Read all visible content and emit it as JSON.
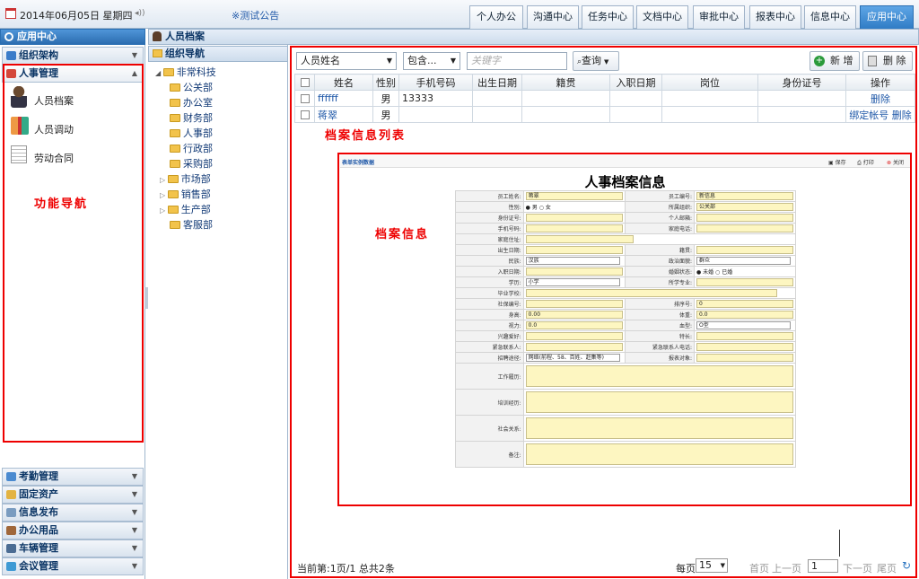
{
  "topbar": {
    "date": "2014年06月05日  星期四",
    "notice": "※测试公告",
    "tabs": [
      "个人办公",
      "沟通中心",
      "任务中心",
      "文档中心",
      "审批中心",
      "报表中心",
      "信息中心",
      "应用中心"
    ]
  },
  "left": {
    "title": "应用中心",
    "org": "组织架构",
    "hr": "人事管理",
    "hr_items": [
      "人员档案",
      "人员调动",
      "劳动合同"
    ],
    "nav_label": "功能导航",
    "bottom": [
      "考勤管理",
      "固定资产",
      "信息发布",
      "办公用品",
      "车辆管理",
      "会议管理"
    ]
  },
  "middle": {
    "panel_title": "人员档案",
    "tree_title": "组织导航",
    "root": "非常科技",
    "depts": [
      "公关部",
      "办公室",
      "财务部",
      "人事部",
      "行政部",
      "采购部",
      "市场部",
      "销售部",
      "生产部",
      "客服部"
    ]
  },
  "toolbar": {
    "field": "人员姓名",
    "op": "包含...",
    "keyword_placeholder": "关键字",
    "query": "查询",
    "add": "新 增",
    "del": "删 除"
  },
  "grid": {
    "headers": [
      "姓名",
      "性别",
      "手机号码",
      "出生日期",
      "籍贯",
      "入职日期",
      "岗位",
      "身份证号",
      "操作"
    ],
    "rows": [
      {
        "name": "ffffff",
        "sex": "男",
        "mobile": "13333",
        "ops": [
          "删除"
        ]
      },
      {
        "name": "蒋翠",
        "sex": "男",
        "mobile": "",
        "ops": [
          "绑定帐号",
          "删除"
        ]
      }
    ]
  },
  "labels": {
    "list": "档案信息列表",
    "info": "档案信息"
  },
  "form": {
    "header": "表单实例数据",
    "save": "保存",
    "print": "打印",
    "close": "关闭",
    "title": "人事档案信息",
    "rows": [
      [
        "员工姓名:",
        "蒋翠",
        "员工编号:",
        "新信息"
      ],
      [
        "性别:",
        "● 男 ○ 女",
        "所属组织:",
        "公关部"
      ],
      [
        "身份证号:",
        "",
        "个人邮箱:",
        ""
      ],
      [
        "手机号码:",
        "",
        "家庭电话:",
        ""
      ],
      [
        "家庭住址:",
        "",
        "",
        ""
      ],
      [
        "出生日期:",
        "",
        "籍贯:",
        ""
      ],
      [
        "民族:",
        "汉族",
        "政治面貌:",
        "群众"
      ],
      [
        "入职日期:",
        "",
        "婚姻状态:",
        "● 未婚 ○ 已婚"
      ],
      [
        "学历:",
        "小学",
        "所学专业:",
        ""
      ],
      [
        "毕业学校:",
        "",
        "",
        ""
      ],
      [
        "社保编号:",
        "",
        "排序号:",
        "0"
      ],
      [
        "身高:",
        "0.00",
        "体重:",
        "0.0"
      ],
      [
        "视力:",
        "0.0",
        "血型:",
        "O型"
      ],
      [
        "兴趣爱好:",
        "",
        "特长:",
        ""
      ],
      [
        "紧急联系人:",
        "",
        "紧急联系人电话:",
        ""
      ],
      [
        "招聘途径:",
        "网络(前程、58、百姓、赶集等)",
        "报表对象:",
        ""
      ]
    ],
    "areas": [
      "工作履历:",
      "培训经历:",
      "社会关系:",
      "备注:"
    ]
  },
  "pager": {
    "info": "当前第:1页/1 总共2条",
    "per_page": "每页",
    "size": "15",
    "first": "首页",
    "prev": "上一页",
    "page": "1",
    "next": "下一页",
    "last": "尾页"
  }
}
